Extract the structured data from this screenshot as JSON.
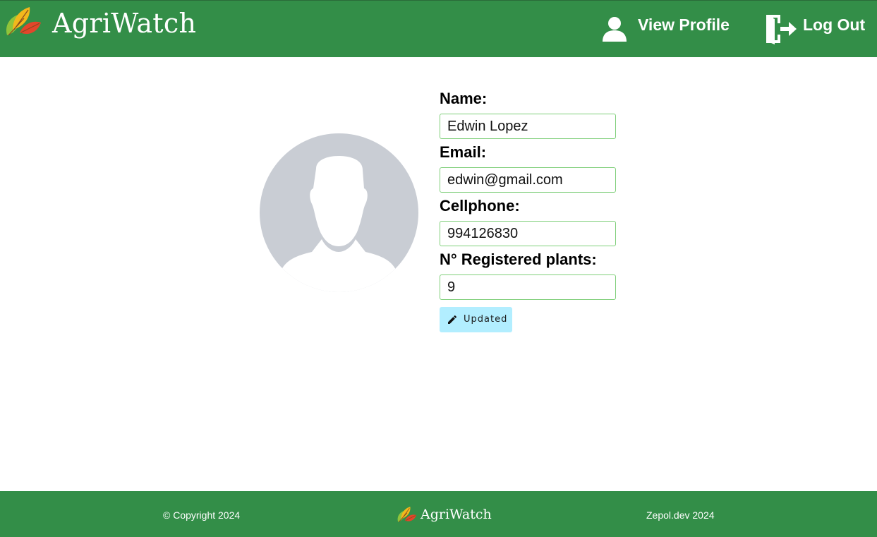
{
  "header": {
    "brand": "AgriWatch",
    "nav": {
      "profile_label": "View Profile",
      "logout_label": "Log Out"
    }
  },
  "icons": {
    "logo": "leaves-logo-icon",
    "profile": "user-icon",
    "logout": "door-exit-icon",
    "avatar": "default-avatar-icon",
    "edit": "pencil-icon"
  },
  "profile": {
    "fields": [
      {
        "label": "Name:",
        "value": "Edwin Lopez"
      },
      {
        "label": "Email:",
        "value": "edwin@gmail.com"
      },
      {
        "label": "Cellphone:",
        "value": "994126830"
      },
      {
        "label": "N° Registered plants:",
        "value": "9"
      }
    ],
    "update_label": "Updated"
  },
  "footer": {
    "copyright": "© Copyright 2024",
    "brand": "AgriWatch",
    "credits": "Zepol.dev 2024"
  },
  "colors": {
    "primary_green": "#338e48",
    "input_border": "#7fcf7a",
    "button_bg": "#b2eeff",
    "avatar_gray": "#c9cdd4"
  }
}
